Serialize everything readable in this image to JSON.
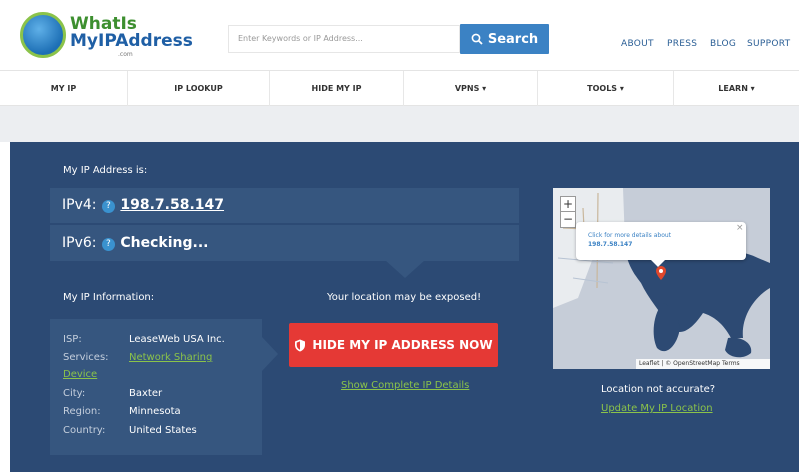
{
  "brand": {
    "logo_line1": "WhatIs",
    "logo_line2": "MyIPAddress",
    "logo_com": ".com"
  },
  "search": {
    "placeholder": "Enter Keywords or IP Address...",
    "button_label": "Search"
  },
  "top_links": [
    "ABOUT",
    "PRESS",
    "BLOG",
    "SUPPORT"
  ],
  "nav": {
    "items": [
      "MY IP",
      "IP LOOKUP",
      "HIDE MY IP",
      "VPNS ▾",
      "TOOLS ▾",
      "LEARN ▾"
    ]
  },
  "hero": {
    "my_ip_label": "My IP Address is:",
    "ipv4_label": "IPv4:",
    "ipv4_value": "198.7.58.147",
    "ipv6_label": "IPv6:",
    "ipv6_value": "Checking...",
    "help_glyph": "?",
    "info_heading": "My IP Information:",
    "info": {
      "isp_key": "ISP:",
      "isp_val": "LeaseWeb USA Inc.",
      "services_key": "Services:",
      "services_val_1": "Network Sharing",
      "services_val_2": "Device",
      "city_key": "City:",
      "city_val": "Baxter",
      "region_key": "Region:",
      "region_val": "Minnesota",
      "country_key": "Country:",
      "country_val": "United States"
    },
    "exposed_text": "Your location may be exposed!",
    "hide_button_label": "HIDE MY IP ADDRESS NOW",
    "details_link": "Show Complete IP Details",
    "location_question": "Location not accurate?",
    "update_link": "Update My IP Location"
  },
  "map": {
    "zoom_in": "+",
    "zoom_out": "−",
    "popup_text": "Click for more details about",
    "popup_ip": "198.7.58.147",
    "popup_close": "×",
    "attribution": "Leaflet | © OpenStreetMap Terms"
  },
  "colors": {
    "hero_bg": "#2c4a74",
    "box_bg": "#36567f",
    "accent_blue": "#3b82c4",
    "cta_red": "#e53935",
    "link_green": "#8bc34a"
  }
}
